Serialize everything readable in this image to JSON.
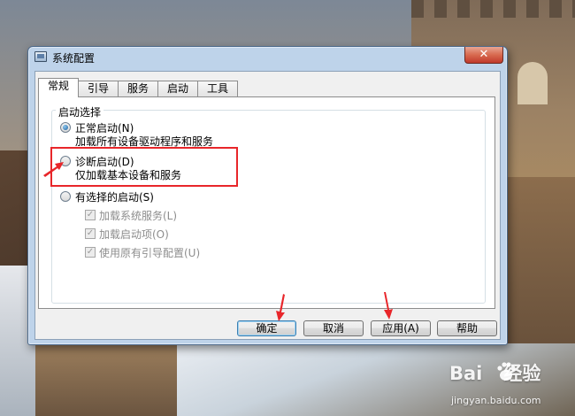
{
  "window": {
    "title": "系统配置",
    "close_symbol": "✕",
    "tabs": [
      {
        "label": "常规",
        "active": true
      },
      {
        "label": "引导",
        "active": false
      },
      {
        "label": "服务",
        "active": false
      },
      {
        "label": "启动",
        "active": false
      },
      {
        "label": "工具",
        "active": false
      }
    ]
  },
  "startup_selection": {
    "legend": "启动选择",
    "normal": {
      "label": "正常启动(N)",
      "description": "加载所有设备驱动程序和服务",
      "checked": true
    },
    "diagnostic": {
      "label": "诊断启动(D)",
      "description": "仅加载基本设备和服务",
      "checked": false
    },
    "selective": {
      "label": "有选择的启动(S)",
      "checked": false,
      "options": [
        {
          "label": "加载系统服务(L)",
          "checked": true,
          "disabled": true
        },
        {
          "label": "加载启动项(O)",
          "checked": true,
          "disabled": true
        },
        {
          "label": "使用原有引导配置(U)",
          "checked": true,
          "disabled": true
        }
      ]
    }
  },
  "buttons": {
    "ok": "确定",
    "cancel": "取消",
    "apply": "应用(A)",
    "help": "帮助"
  },
  "annotation_color": "#e8262a",
  "icons": [
    "window-icon",
    "close-icon",
    "radio-icon",
    "checkbox-icon",
    "red-arrow-icon",
    "baidu-paw-icon"
  ],
  "watermark": {
    "logo_left": "Bai",
    "logo_right": "经验",
    "url": "jingyan.baidu.com"
  }
}
